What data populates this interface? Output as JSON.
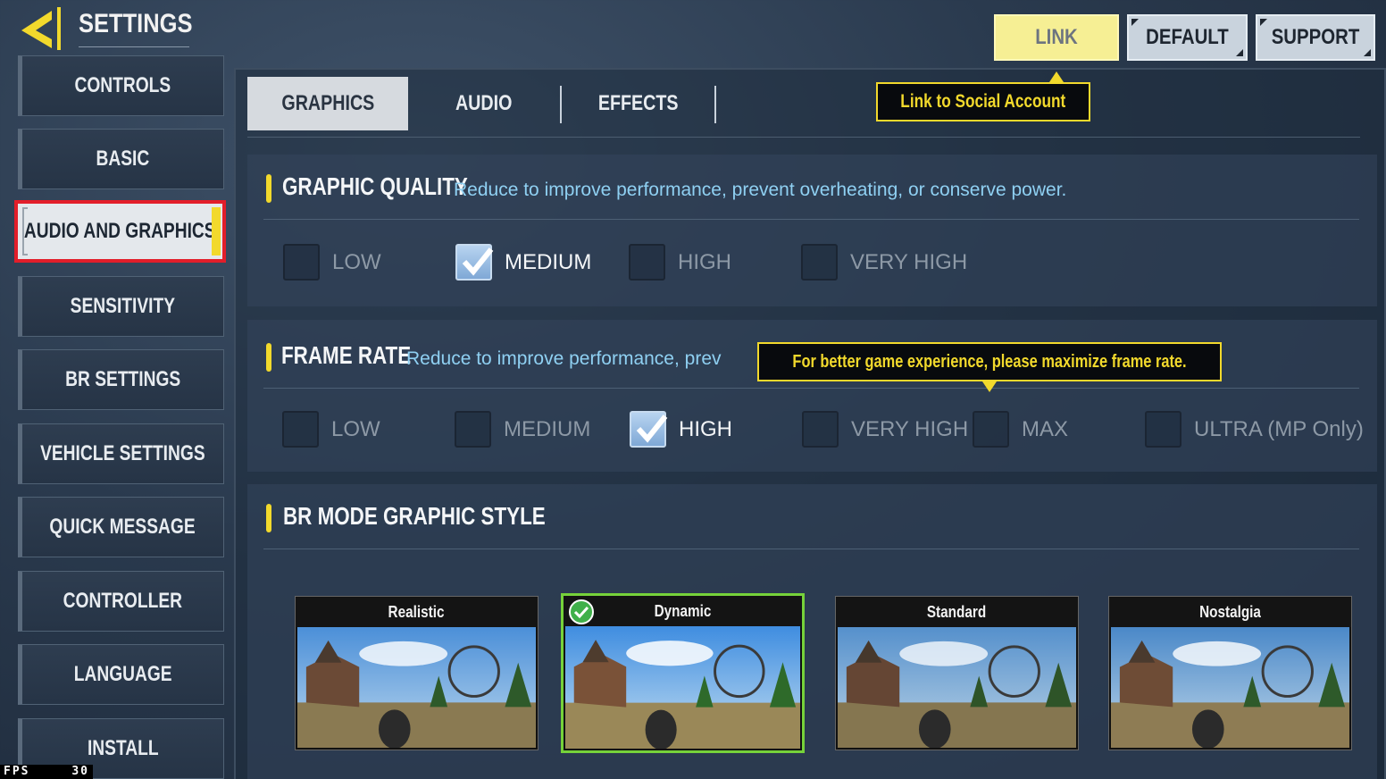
{
  "header": {
    "title": "SETTINGS",
    "buttons": {
      "link": "LINK",
      "default": "DEFAULT",
      "support": "SUPPORT"
    }
  },
  "sidebar": {
    "items": [
      {
        "label": "CONTROLS"
      },
      {
        "label": "BASIC"
      },
      {
        "label": "AUDIO AND GRAPHICS",
        "active": true
      },
      {
        "label": "SENSITIVITY"
      },
      {
        "label": "BR SETTINGS"
      },
      {
        "label": "VEHICLE SETTINGS"
      },
      {
        "label": "QUICK MESSAGE"
      },
      {
        "label": "CONTROLLER"
      },
      {
        "label": "LANGUAGE"
      },
      {
        "label": "INSTALL"
      }
    ]
  },
  "tabs": {
    "graphics": "GRAPHICS",
    "audio": "AUDIO",
    "effects": "EFFECTS",
    "selected": "GRAPHICS"
  },
  "social_tooltip": "Link to Social Account",
  "graphic_quality": {
    "title": "GRAPHIC QUALITY",
    "description": "Reduce to improve performance, prevent overheating, or conserve power.",
    "options": [
      "LOW",
      "MEDIUM",
      "HIGH",
      "VERY HIGH"
    ],
    "selected": "MEDIUM"
  },
  "frame_rate": {
    "title": "FRAME RATE",
    "description": "Reduce to improve performance, prev",
    "tooltip": "For better game experience, please maximize frame rate.",
    "options": [
      "LOW",
      "MEDIUM",
      "HIGH",
      "VERY HIGH",
      "MAX",
      "ULTRA (MP Only)"
    ],
    "selected": "HIGH"
  },
  "br_style": {
    "title": "BR MODE GRAPHIC STYLE",
    "styles": [
      "Realistic",
      "Dynamic",
      "Standard",
      "Nostalgia"
    ],
    "selected": "Dynamic"
  },
  "fps": {
    "label": "FPS",
    "value": "30"
  },
  "colors": {
    "accent_yellow": "#f2d92c",
    "selected_green": "#76d23a",
    "active_outline_red": "#e21e2a",
    "desc_blue": "#8fd0f2"
  }
}
